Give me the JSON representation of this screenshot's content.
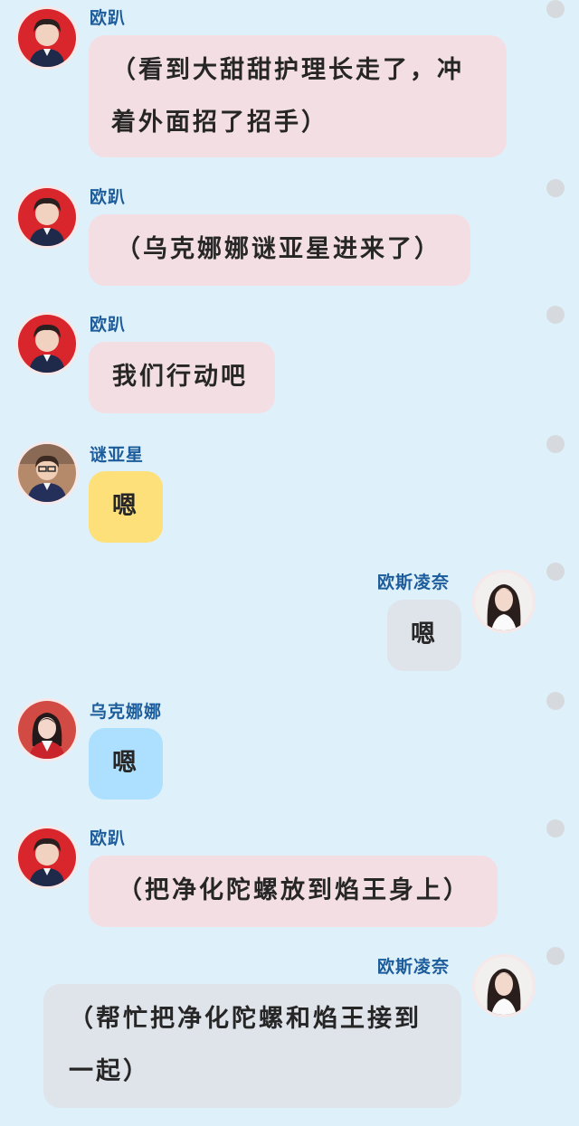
{
  "messages": [
    {
      "id": 1,
      "sender": "欧趴",
      "side": "left",
      "avatar": "ou-pa-avatar",
      "text": "（看到大甜甜护理长走了，冲着外面招了招手）",
      "lines": [
        "（看到大甜甜护理长走了，冲",
        "着外面招了招手）"
      ],
      "bubble_color": "#f3dfe3"
    },
    {
      "id": 2,
      "sender": "欧趴",
      "side": "left",
      "avatar": "ou-pa-avatar",
      "text": "（乌克娜娜谜亚星进来了）",
      "lines": [
        "（乌克娜娜谜亚星进来了）"
      ],
      "bubble_color": "#f3dfe3"
    },
    {
      "id": 3,
      "sender": "欧趴",
      "side": "left",
      "avatar": "ou-pa-avatar",
      "text": "我们行动吧",
      "lines": [
        "我们行动吧"
      ],
      "bubble_color": "#f3dfe3"
    },
    {
      "id": 4,
      "sender": "谜亚星",
      "side": "left",
      "avatar": "mi-ya-xing-avatar",
      "text": "嗯",
      "lines": [
        "嗯"
      ],
      "bubble_color": "#fde07a"
    },
    {
      "id": 5,
      "sender": "欧斯凌奈",
      "side": "right",
      "avatar": "ou-si-ling-nai-avatar",
      "text": "嗯",
      "lines": [
        "嗯"
      ],
      "bubble_color": "#dfe3ea"
    },
    {
      "id": 6,
      "sender": "乌克娜娜",
      "side": "left",
      "avatar": "wu-ke-na-na-avatar",
      "text": "嗯",
      "lines": [
        "嗯"
      ],
      "bubble_color": "#addfff"
    },
    {
      "id": 7,
      "sender": "欧趴",
      "side": "left",
      "avatar": "ou-pa-avatar",
      "text": "（把净化陀螺放到焰王身上）",
      "lines": [
        "（把净化陀螺放到焰王身上）"
      ],
      "bubble_color": "#f3dfe3"
    },
    {
      "id": 8,
      "sender": "欧斯凌奈",
      "side": "right",
      "avatar": "ou-si-ling-nai-avatar",
      "text": "（帮忙把净化陀螺和焰王接到一起）",
      "lines": [
        "（帮忙把净化陀螺和焰王接到",
        "一起）"
      ],
      "bubble_color": "#dfe3ea"
    }
  ]
}
